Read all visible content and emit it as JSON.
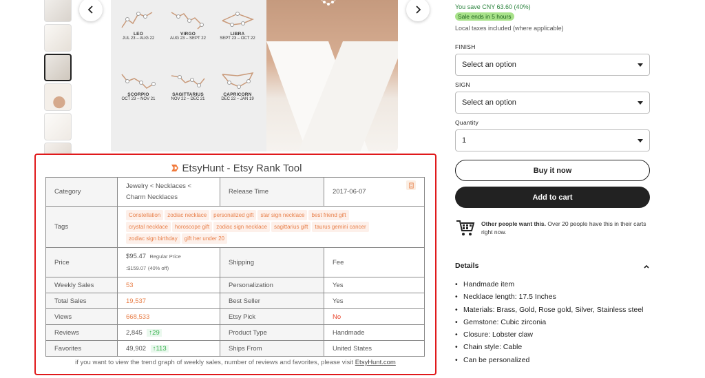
{
  "gallery": {
    "thumbnails": [
      "thumb-1",
      "thumb-2",
      "thumb-3",
      "thumb-4",
      "thumb-5",
      "thumb-6"
    ],
    "signs": [
      {
        "name": "LEO",
        "date": "JUL 23 – AUG 22"
      },
      {
        "name": "VIRGO",
        "date": "AUG 23 – SEPT 22"
      },
      {
        "name": "LIBRA",
        "date": "SEPT 23 – OCT 22"
      },
      {
        "name": "SCORPIO",
        "date": "OCT 23 – NOV 21"
      },
      {
        "name": "SAGITTARIUS",
        "date": "NOV 22 – DEC 21"
      },
      {
        "name": "CAPRICORN",
        "date": "DEC 22 – JAN 19"
      }
    ]
  },
  "etsyhunt": {
    "title": "EtsyHunt - Etsy Rank Tool",
    "rows": {
      "category_label": "Category",
      "category_value": "Jewelry < Necklaces < Charm Necklaces",
      "release_label": "Release Time",
      "release_value": "2017-06-07",
      "tags_label": "Tags",
      "tags": [
        "Constellation",
        "zodiac necklace",
        "personalized gift",
        "star sign necklace",
        "best friend gift",
        "crystal necklace",
        "horoscope gift",
        "zodiac sign necklace",
        "sagittarius gift",
        "taurus gemini cancer",
        "zodiac sign birthday",
        "gift her under 20"
      ],
      "price_label": "Price",
      "price_value": "$95.47",
      "price_regular": "Regular Price",
      "price_sale": ":$159.07",
      "price_off": "(40% off)",
      "shipping_label": "Shipping",
      "shipping_value": "Fee",
      "weekly_label": "Weekly Sales",
      "weekly_value": "53",
      "personalization_label": "Personalization",
      "personalization_value": "Yes",
      "total_label": "Total Sales",
      "total_value": "19,537",
      "bestseller_label": "Best Seller",
      "bestseller_value": "Yes",
      "views_label": "Views",
      "views_value": "668,533",
      "etsypick_label": "Etsy Pick",
      "etsypick_value": "No",
      "reviews_label": "Reviews",
      "reviews_value": "2,845",
      "reviews_delta": "29",
      "producttype_label": "Product Type",
      "producttype_value": "Handmade",
      "favorites_label": "Favorites",
      "favorites_value": "49,902",
      "favorites_delta": "113",
      "shipsfrom_label": "Ships From",
      "shipsfrom_value": "United States"
    },
    "footer_text": "if you want to view the trend graph of weekly sales, number of reviews and favorites, please visit",
    "footer_link": "EtsyHunt.com"
  },
  "purchase": {
    "save_text": "You save CNY 63.60 (40%)",
    "sale_badge": "Sale ends in 5 hours",
    "tax_text": "Local taxes included (where applicable)",
    "finish_label": "FINISH",
    "finish_value": "Select an option",
    "sign_label": "SIGN",
    "sign_value": "Select an option",
    "quantity_label": "Quantity",
    "quantity_value": "1",
    "buy_now": "Buy it now",
    "add_to_cart": "Add to cart",
    "demand_bold": "Other people want this.",
    "demand_text": " Over 20 people have this in their carts right now.",
    "details_title": "Details",
    "details": [
      "Handmade item",
      "Necklace length: 17.5 Inches",
      "Materials: Brass, Gold, Rose gold, Silver, Stainless steel",
      "Gemstone: Cubic zirconia",
      "Closure: Lobster claw",
      "Chain style: Cable",
      "Can be personalized"
    ]
  },
  "colors": {
    "accent_red": "#e0191b",
    "orange": "#e8804b",
    "green": "#37b24d",
    "dark_button": "#222222"
  }
}
